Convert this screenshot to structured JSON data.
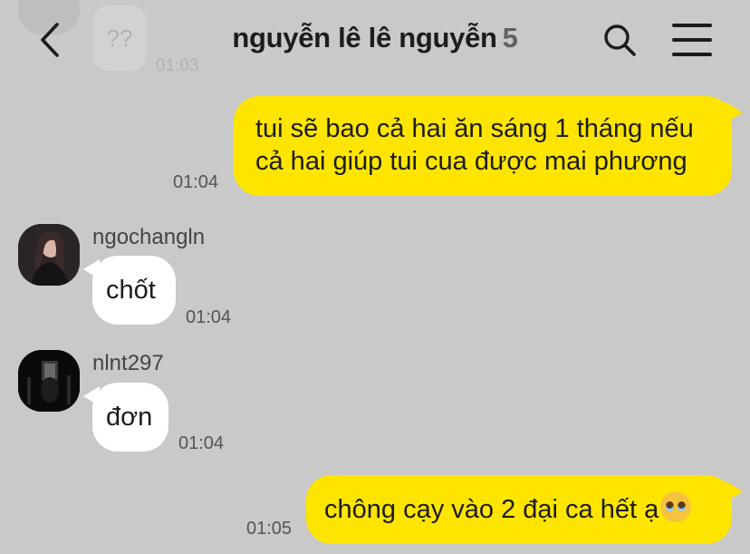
{
  "header": {
    "title": "nguyễn lê lê nguyễn",
    "member_count": "5"
  },
  "previous": {
    "bubble": "??",
    "time": "01:03"
  },
  "messages": [
    {
      "sender": "me",
      "lines": [
        "tui sẽ bao cả hai ăn sáng 1 tháng nếu",
        "cả hai giúp tui cua được mai phương"
      ],
      "time": "01:04"
    },
    {
      "sender": "ngochangln",
      "text": "chốt",
      "time": "01:04"
    },
    {
      "sender": "nlnt297",
      "text": "đơn",
      "time": "01:04"
    },
    {
      "sender": "me",
      "text": "chông cạy vào 2 đại ca hết ạ",
      "emoji": "pleading-face",
      "time": "01:05"
    }
  ],
  "colors": {
    "background": "#c9c9c9",
    "my_bubble": "#fee500",
    "their_bubble": "#ffffff"
  }
}
